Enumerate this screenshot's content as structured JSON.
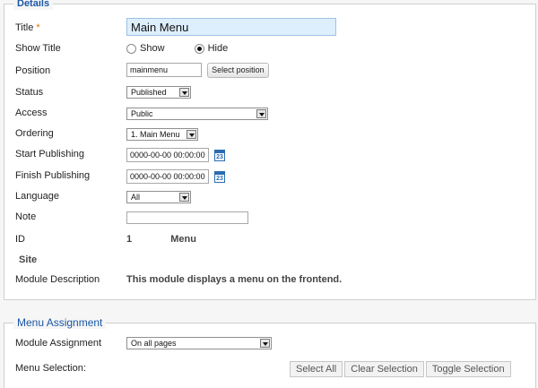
{
  "details": {
    "legend": "Details",
    "title": {
      "label": "Title",
      "required_mark": "*",
      "value": "Main Menu"
    },
    "show_title": {
      "label": "Show Title",
      "options": [
        "Show",
        "Hide"
      ],
      "selected": "Hide"
    },
    "position": {
      "label": "Position",
      "value": "mainmenu",
      "button": "Select position"
    },
    "status": {
      "label": "Status",
      "value": "Published"
    },
    "access": {
      "label": "Access",
      "value": "Public"
    },
    "ordering": {
      "label": "Ordering",
      "value": "1. Main Menu"
    },
    "start_publishing": {
      "label": "Start Publishing",
      "value": "0000-00-00 00:00:00",
      "calendar_day": "23"
    },
    "finish_publishing": {
      "label": "Finish Publishing",
      "value": "0000-00-00 00:00:00",
      "calendar_day": "23"
    },
    "language": {
      "label": "Language",
      "value": "All"
    },
    "note": {
      "label": "Note",
      "value": ""
    },
    "id": {
      "label": "ID",
      "value": "1",
      "type": "Menu"
    },
    "client": {
      "label": "Site"
    },
    "module_description": {
      "label": "Module Description",
      "value": "This module displays a menu on the frontend."
    }
  },
  "assignment": {
    "legend": "Menu Assignment",
    "module_assignment": {
      "label": "Module Assignment",
      "value": "On all pages"
    },
    "menu_selection": {
      "label": "Menu Selection:"
    },
    "buttons": {
      "select_all": "Select All",
      "clear_selection": "Clear Selection",
      "toggle_selection": "Toggle Selection"
    }
  }
}
